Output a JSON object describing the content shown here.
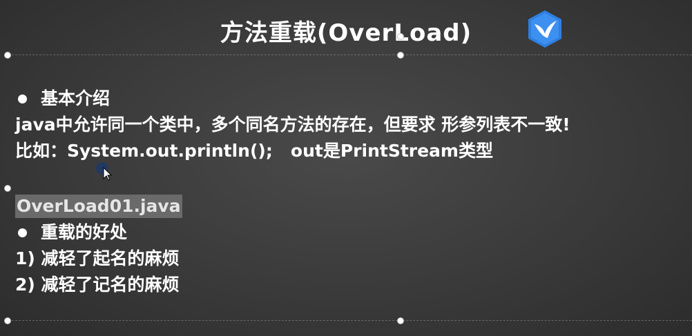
{
  "slide": {
    "title": "方法重载(OverLoad)",
    "section1": {
      "heading": "基本介绍",
      "line1": "java中允许同一个类中，多个同名方法的存在，但要求 形参列表不一致!",
      "line2": "比如：System.out.println();   out是PrintStream类型"
    },
    "file_label": "OverLoad01.java",
    "section2": {
      "heading": "重载的好处",
      "items": [
        "1) 减轻了起名的麻烦",
        "2) 减轻了记名的麻烦"
      ]
    }
  },
  "colors": {
    "background": "#3a3a3a",
    "text": "#ffffff",
    "logo_blue": "#2f7fe0"
  },
  "icons": [
    "bird-logo-icon",
    "mouse-cursor-icon",
    "bullet-icon"
  ]
}
